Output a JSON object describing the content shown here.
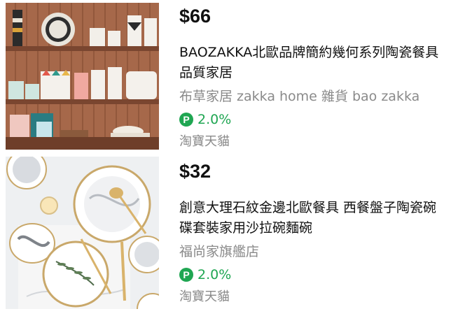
{
  "products": [
    {
      "price": "$66",
      "title": "BAOZAKKA北歐品牌簡約幾何系列陶瓷餐具品質家居",
      "store": "布草家居 zakka home 雜貨 bao zakka",
      "cashback_icon": "P",
      "cashback_rate": "2.0%",
      "platform": "淘寶天貓"
    },
    {
      "price": "$32",
      "title": "創意大理石紋金邊北歐餐具 西餐盤子陶瓷碗碟套裝家用沙拉碗麵碗",
      "store": "福尚家旗艦店",
      "cashback_icon": "P",
      "cashback_rate": "2.0%",
      "platform": "淘寶天貓"
    }
  ],
  "colors": {
    "cashback_green": "#1fa652",
    "muted_text": "#8a8a8a"
  }
}
